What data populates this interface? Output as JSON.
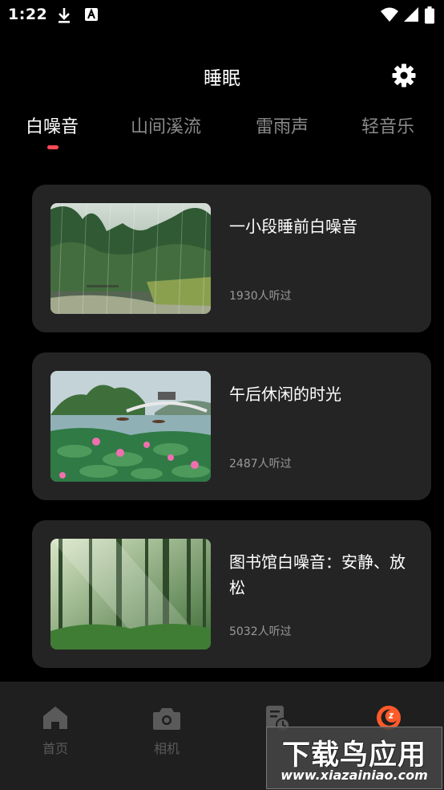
{
  "status_bar": {
    "time": "1:22",
    "icons": [
      "download-icon",
      "a-icon",
      "wifi-icon",
      "cellular-icon",
      "battery-icon"
    ]
  },
  "header": {
    "title": "睡眠",
    "settings_icon": "gear-icon"
  },
  "tabs": [
    {
      "label": "白噪音",
      "active": true
    },
    {
      "label": "山间溪流",
      "active": false
    },
    {
      "label": "雷雨声",
      "active": false
    },
    {
      "label": "轻音乐",
      "active": false
    }
  ],
  "accent_color": "#ff4a57",
  "cards": [
    {
      "title": "一小段睡前白噪音",
      "count": "1930人听过",
      "image": "rainy-forest-pond-image"
    },
    {
      "title": "午后休闲的时光",
      "count": "2487人听过",
      "image": "lotus-lake-bridge-image"
    },
    {
      "title": "图书馆白噪音：安静、放松",
      "count": "5032人听过",
      "image": "sunlit-forest-image"
    }
  ],
  "bottom_nav": [
    {
      "label": "首页",
      "icon": "home-icon"
    },
    {
      "label": "相机",
      "icon": "camera-icon"
    },
    {
      "label": "",
      "icon": "history-icon"
    },
    {
      "label": "",
      "icon": "sleep-moon-icon"
    }
  ],
  "watermark": {
    "main": "下载鸟应用",
    "sub": "www.xiazainiao.com"
  }
}
